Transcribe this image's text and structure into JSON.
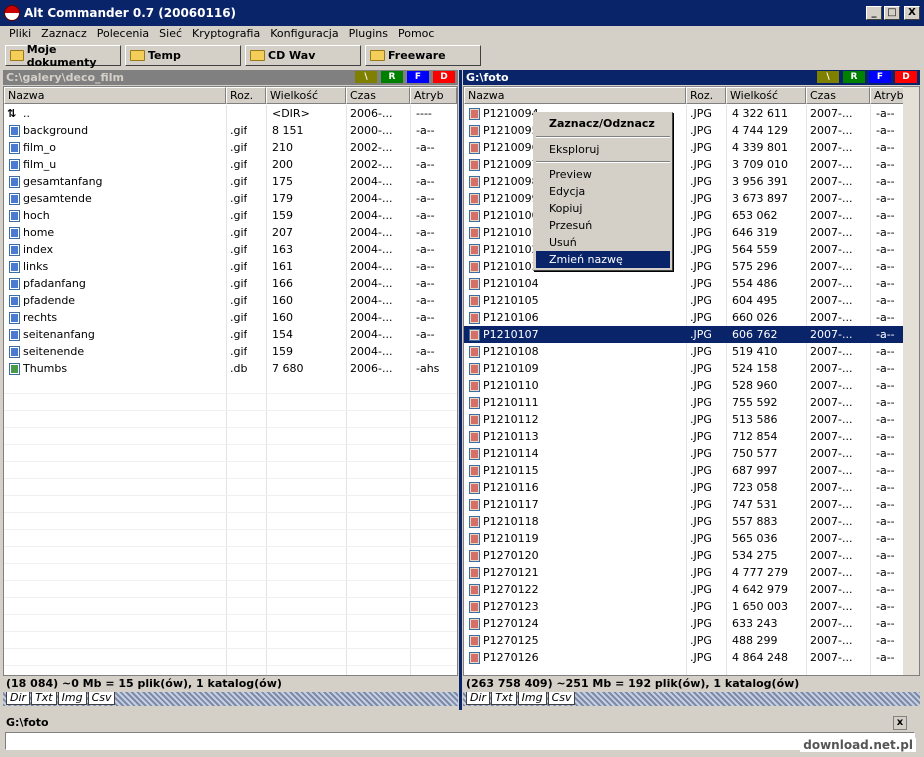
{
  "window": {
    "title": "Alt Commander 0.7 (20060116)",
    "min": "_",
    "max": "□",
    "close": "X"
  },
  "menu": [
    "Pliki",
    "Zaznacz",
    "Polecenia",
    "Sieć",
    "Kryptografia",
    "Konfiguracja",
    "Plugins",
    "Pomoc"
  ],
  "favorites": [
    "Moje dokumenty",
    "Temp",
    "CD Wav",
    "Freeware"
  ],
  "drive_tabs": [
    "\\",
    "R",
    "F",
    "D"
  ],
  "drive_tab_colors": [
    "#808000",
    "#008000",
    "#0000ff",
    "#ff0000"
  ],
  "columns": [
    "Nazwa",
    "Roz.",
    "Wielkość",
    "Czas",
    "Atryb"
  ],
  "left": {
    "path": "C:\\galery\\deco_film",
    "rows": [
      {
        "n": "..",
        "e": "",
        "s": "<DIR>",
        "t": "2006-...",
        "a": "----",
        "icon": "up-arrow-icon"
      },
      {
        "n": "background",
        "e": ".gif",
        "s": "8 151",
        "t": "2000-...",
        "a": "-a--"
      },
      {
        "n": "film_o",
        "e": ".gif",
        "s": "210",
        "t": "2002-...",
        "a": "-a--"
      },
      {
        "n": "film_u",
        "e": ".gif",
        "s": "200",
        "t": "2002-...",
        "a": "-a--"
      },
      {
        "n": "gesamtanfang",
        "e": ".gif",
        "s": "175",
        "t": "2004-...",
        "a": "-a--"
      },
      {
        "n": "gesamtende",
        "e": ".gif",
        "s": "179",
        "t": "2004-...",
        "a": "-a--"
      },
      {
        "n": "hoch",
        "e": ".gif",
        "s": "159",
        "t": "2004-...",
        "a": "-a--"
      },
      {
        "n": "home",
        "e": ".gif",
        "s": "207",
        "t": "2004-...",
        "a": "-a--"
      },
      {
        "n": "index",
        "e": ".gif",
        "s": "163",
        "t": "2004-...",
        "a": "-a--"
      },
      {
        "n": "links",
        "e": ".gif",
        "s": "161",
        "t": "2004-...",
        "a": "-a--"
      },
      {
        "n": "pfadanfang",
        "e": ".gif",
        "s": "166",
        "t": "2004-...",
        "a": "-a--"
      },
      {
        "n": "pfadende",
        "e": ".gif",
        "s": "160",
        "t": "2004-...",
        "a": "-a--"
      },
      {
        "n": "rechts",
        "e": ".gif",
        "s": "160",
        "t": "2004-...",
        "a": "-a--"
      },
      {
        "n": "seitenanfang",
        "e": ".gif",
        "s": "154",
        "t": "2004-...",
        "a": "-a--"
      },
      {
        "n": "seitenende",
        "e": ".gif",
        "s": "159",
        "t": "2004-...",
        "a": "-a--"
      },
      {
        "n": "Thumbs",
        "e": ".db",
        "s": "7 680",
        "t": "2006-...",
        "a": "-ahs"
      }
    ],
    "status": "(18 084) ~0 Mb = 15 plik(ów), 1 katalog(ów)"
  },
  "right": {
    "path": "G:\\foto",
    "selected_index": 13,
    "rows": [
      {
        "n": "P1210094",
        "e": ".JPG",
        "s": "4 322 611",
        "t": "2007-...",
        "a": "-a--"
      },
      {
        "n": "P1210095",
        "e": ".JPG",
        "s": "4 744 129",
        "t": "2007-...",
        "a": "-a--"
      },
      {
        "n": "P1210096",
        "e": ".JPG",
        "s": "4 339 801",
        "t": "2007-...",
        "a": "-a--"
      },
      {
        "n": "P1210097",
        "e": ".JPG",
        "s": "3 709 010",
        "t": "2007-...",
        "a": "-a--"
      },
      {
        "n": "P1210098",
        "e": ".JPG",
        "s": "3 956 391",
        "t": "2007-...",
        "a": "-a--"
      },
      {
        "n": "P1210099",
        "e": ".JPG",
        "s": "3 673 897",
        "t": "2007-...",
        "a": "-a--"
      },
      {
        "n": "P1210100",
        "e": ".JPG",
        "s": "653 062",
        "t": "2007-...",
        "a": "-a--"
      },
      {
        "n": "P1210101",
        "e": ".JPG",
        "s": "646 319",
        "t": "2007-...",
        "a": "-a--"
      },
      {
        "n": "P1210102",
        "e": ".JPG",
        "s": "564 559",
        "t": "2007-...",
        "a": "-a--"
      },
      {
        "n": "P1210103",
        "e": ".JPG",
        "s": "575 296",
        "t": "2007-...",
        "a": "-a--"
      },
      {
        "n": "P1210104",
        "e": ".JPG",
        "s": "554 486",
        "t": "2007-...",
        "a": "-a--"
      },
      {
        "n": "P1210105",
        "e": ".JPG",
        "s": "604 495",
        "t": "2007-...",
        "a": "-a--"
      },
      {
        "n": "P1210106",
        "e": ".JPG",
        "s": "660 026",
        "t": "2007-...",
        "a": "-a--"
      },
      {
        "n": "P1210107",
        "e": ".JPG",
        "s": "606 762",
        "t": "2007-...",
        "a": "-a--"
      },
      {
        "n": "P1210108",
        "e": ".JPG",
        "s": "519 410",
        "t": "2007-...",
        "a": "-a--"
      },
      {
        "n": "P1210109",
        "e": ".JPG",
        "s": "524 158",
        "t": "2007-...",
        "a": "-a--"
      },
      {
        "n": "P1210110",
        "e": ".JPG",
        "s": "528 960",
        "t": "2007-...",
        "a": "-a--"
      },
      {
        "n": "P1210111",
        "e": ".JPG",
        "s": "755 592",
        "t": "2007-...",
        "a": "-a--"
      },
      {
        "n": "P1210112",
        "e": ".JPG",
        "s": "513 586",
        "t": "2007-...",
        "a": "-a--"
      },
      {
        "n": "P1210113",
        "e": ".JPG",
        "s": "712 854",
        "t": "2007-...",
        "a": "-a--"
      },
      {
        "n": "P1210114",
        "e": ".JPG",
        "s": "750 577",
        "t": "2007-...",
        "a": "-a--"
      },
      {
        "n": "P1210115",
        "e": ".JPG",
        "s": "687 997",
        "t": "2007-...",
        "a": "-a--"
      },
      {
        "n": "P1210116",
        "e": ".JPG",
        "s": "723 058",
        "t": "2007-...",
        "a": "-a--"
      },
      {
        "n": "P1210117",
        "e": ".JPG",
        "s": "747 531",
        "t": "2007-...",
        "a": "-a--"
      },
      {
        "n": "P1210118",
        "e": ".JPG",
        "s": "557 883",
        "t": "2007-...",
        "a": "-a--"
      },
      {
        "n": "P1210119",
        "e": ".JPG",
        "s": "565 036",
        "t": "2007-...",
        "a": "-a--"
      },
      {
        "n": "P1270120",
        "e": ".JPG",
        "s": "534 275",
        "t": "2007-...",
        "a": "-a--"
      },
      {
        "n": "P1270121",
        "e": ".JPG",
        "s": "4 777 279",
        "t": "2007-...",
        "a": "-a--"
      },
      {
        "n": "P1270122",
        "e": ".JPG",
        "s": "4 642 979",
        "t": "2007-...",
        "a": "-a--"
      },
      {
        "n": "P1270123",
        "e": ".JPG",
        "s": "1 650 003",
        "t": "2007-...",
        "a": "-a--"
      },
      {
        "n": "P1270124",
        "e": ".JPG",
        "s": "633 243",
        "t": "2007-...",
        "a": "-a--"
      },
      {
        "n": "P1270125",
        "e": ".JPG",
        "s": "488 299",
        "t": "2007-...",
        "a": "-a--"
      },
      {
        "n": "P1270126",
        "e": ".JPG",
        "s": "4 864 248",
        "t": "2007-...",
        "a": "-a--"
      }
    ],
    "status": "(263 758 409) ~251 Mb = 192 plik(ów), 1 katalog(ów)"
  },
  "view_tabs": [
    "Dir",
    "Txt",
    "Img",
    "Csv"
  ],
  "context_menu": {
    "header": "Zaznacz/Odznacz",
    "items": [
      "Eksploruj",
      "Preview",
      "Edycja",
      "Kopiuj",
      "Przesuń",
      "Usuń",
      "Zmień nazwę"
    ],
    "highlighted": "Zmień nazwę"
  },
  "command": {
    "label": "G:\\foto",
    "value": "",
    "close": "x"
  },
  "watermark": "download.net.pl",
  "colors": {
    "selection": "#0a246a",
    "face": "#d4d0c8"
  }
}
